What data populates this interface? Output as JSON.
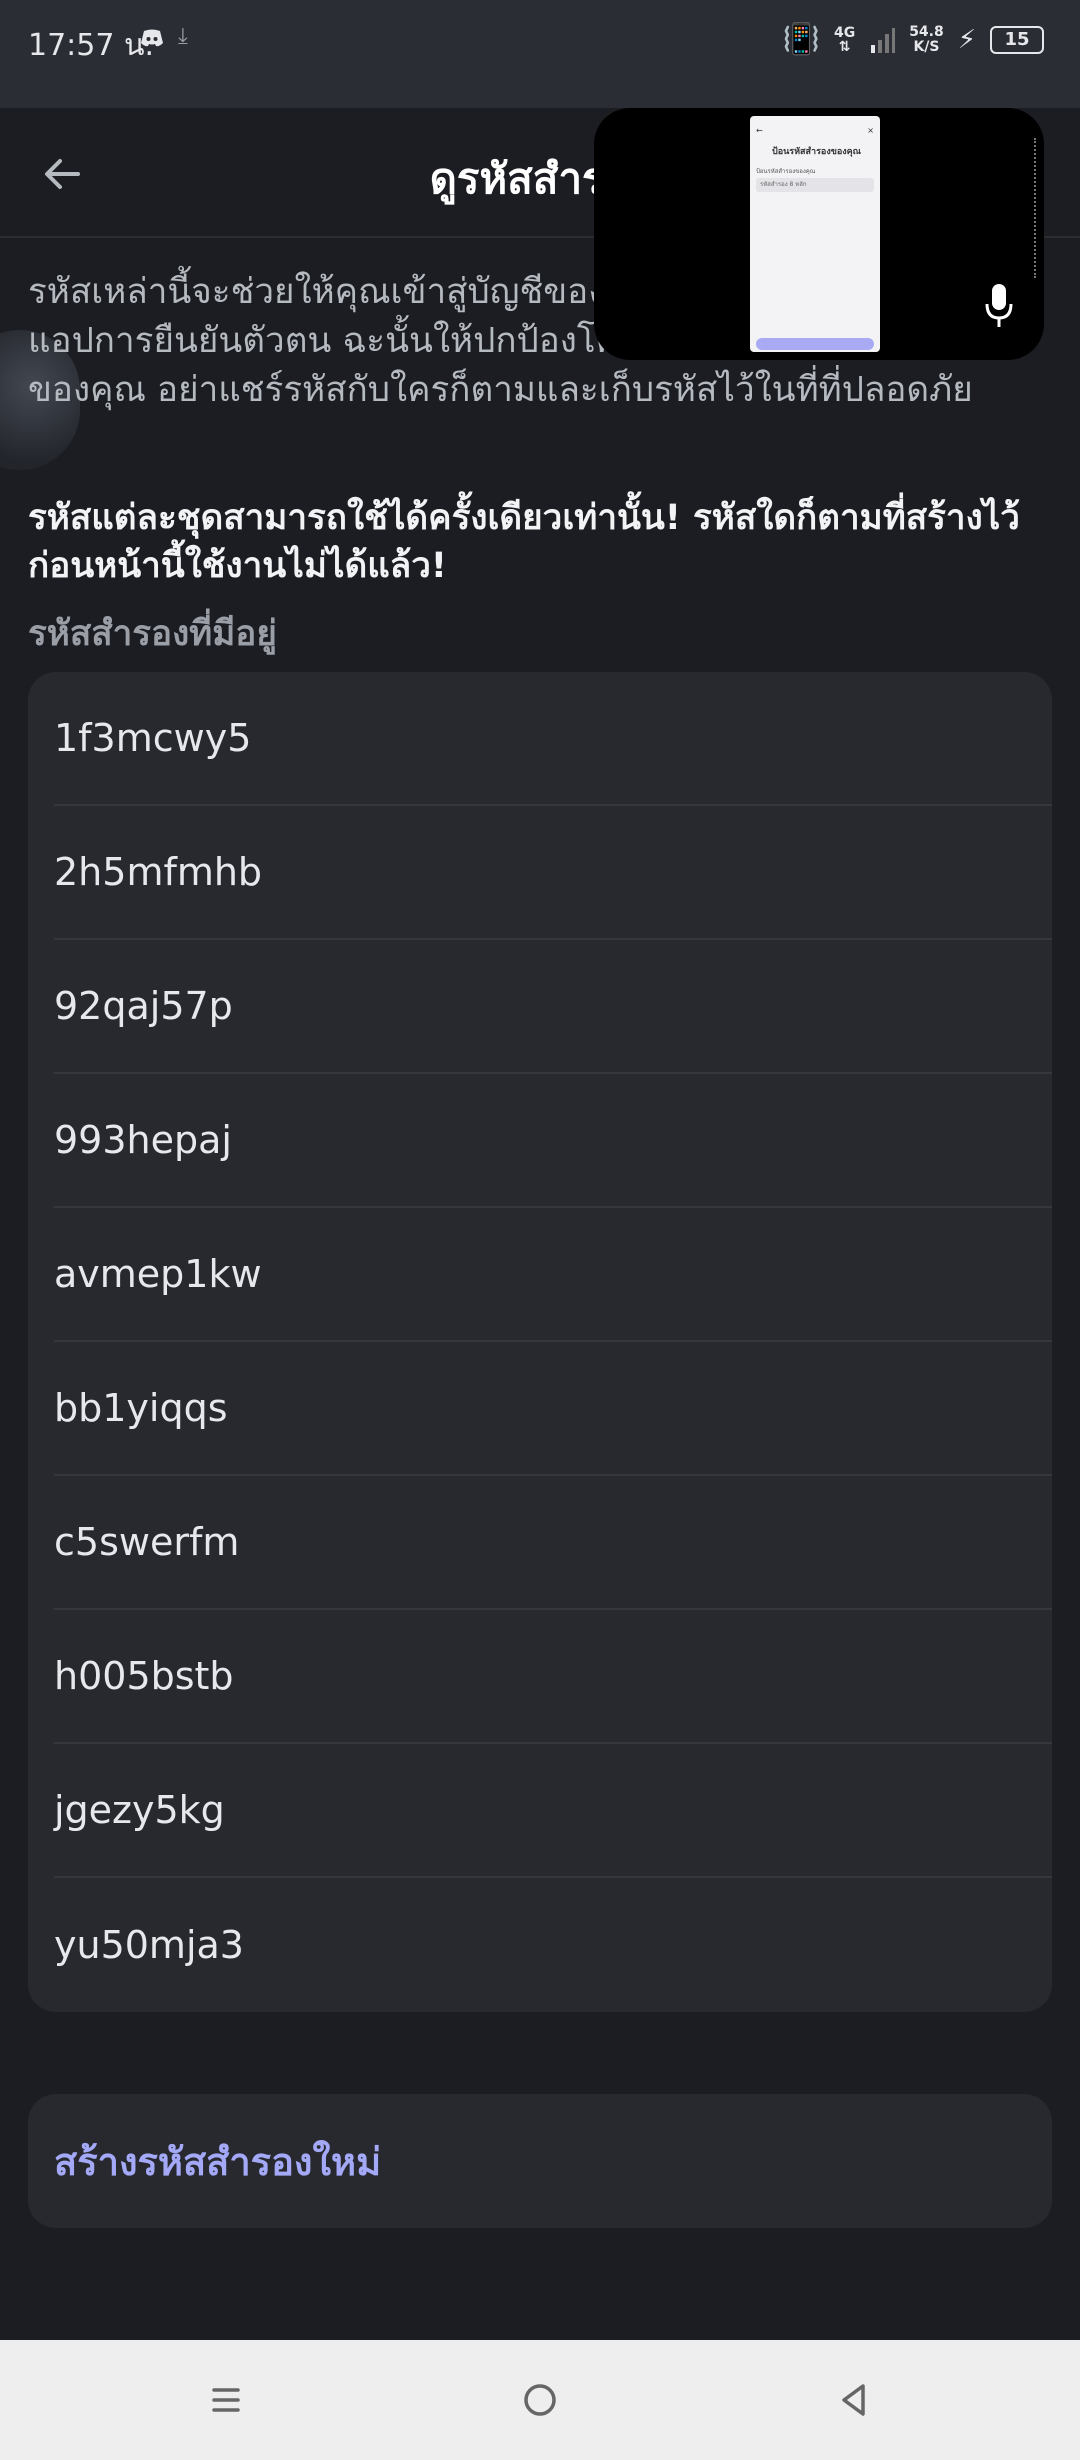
{
  "status_bar": {
    "time": "17:57 น.",
    "network": "4G",
    "speed_value": "54.8",
    "speed_unit": "K/S",
    "battery": "15"
  },
  "header": {
    "title": "ดูรหัสสำรอง"
  },
  "pip": {
    "screen_title": "ป้อนรหัสสำรองของคุณ",
    "screen_subtitle": "ป้อนรหัสสำรองของคุณ",
    "input_placeholder": "รหัสสำรอง 8 หลัก"
  },
  "content": {
    "description": "รหัสเหล่านี้จะช่วยให้คุณเข้าสู่บัญชีของคุณได้หากคุณไม่สามารถใช้แอปการยืนยันตัวตน ฉะนั้นให้ปกป้องโค้ดเหล่านี้เหมือนกับรหัสผ่านของคุณ อย่าแชร์รหัสกับใครก็ตามและเก็บรหัสไว้ในที่ที่ปลอดภัย",
    "warning": "รหัสแต่ละชุดสามารถใช้ได้ครั้งเดียวเท่านั้น! รหัสใดก็ตามที่สร้างไว้ก่อนหน้านี้ใช้งานไม่ได้แล้ว!",
    "section_label": "รหัสสำรองที่มีอยู่",
    "codes": [
      "1f3mcwy5",
      "2h5mfmhb",
      "92qaj57p",
      "993hepaj",
      "avmep1kw",
      "bb1yiqqs",
      "c5swerfm",
      "h005bstb",
      "jgezy5kg",
      "yu50mja3"
    ],
    "generate_new_label": "สร้างรหัสสำรองใหม่"
  },
  "colors": {
    "background": "#1c1d23",
    "card": "#27292f",
    "accent": "#a4a9f7",
    "navbar": "#eeeeee"
  },
  "icons": {
    "back": "arrow-left-icon",
    "mic": "microphone-icon",
    "nav_menu": "menu-icon",
    "nav_home": "home-circle-icon",
    "nav_back": "triangle-back-icon"
  }
}
